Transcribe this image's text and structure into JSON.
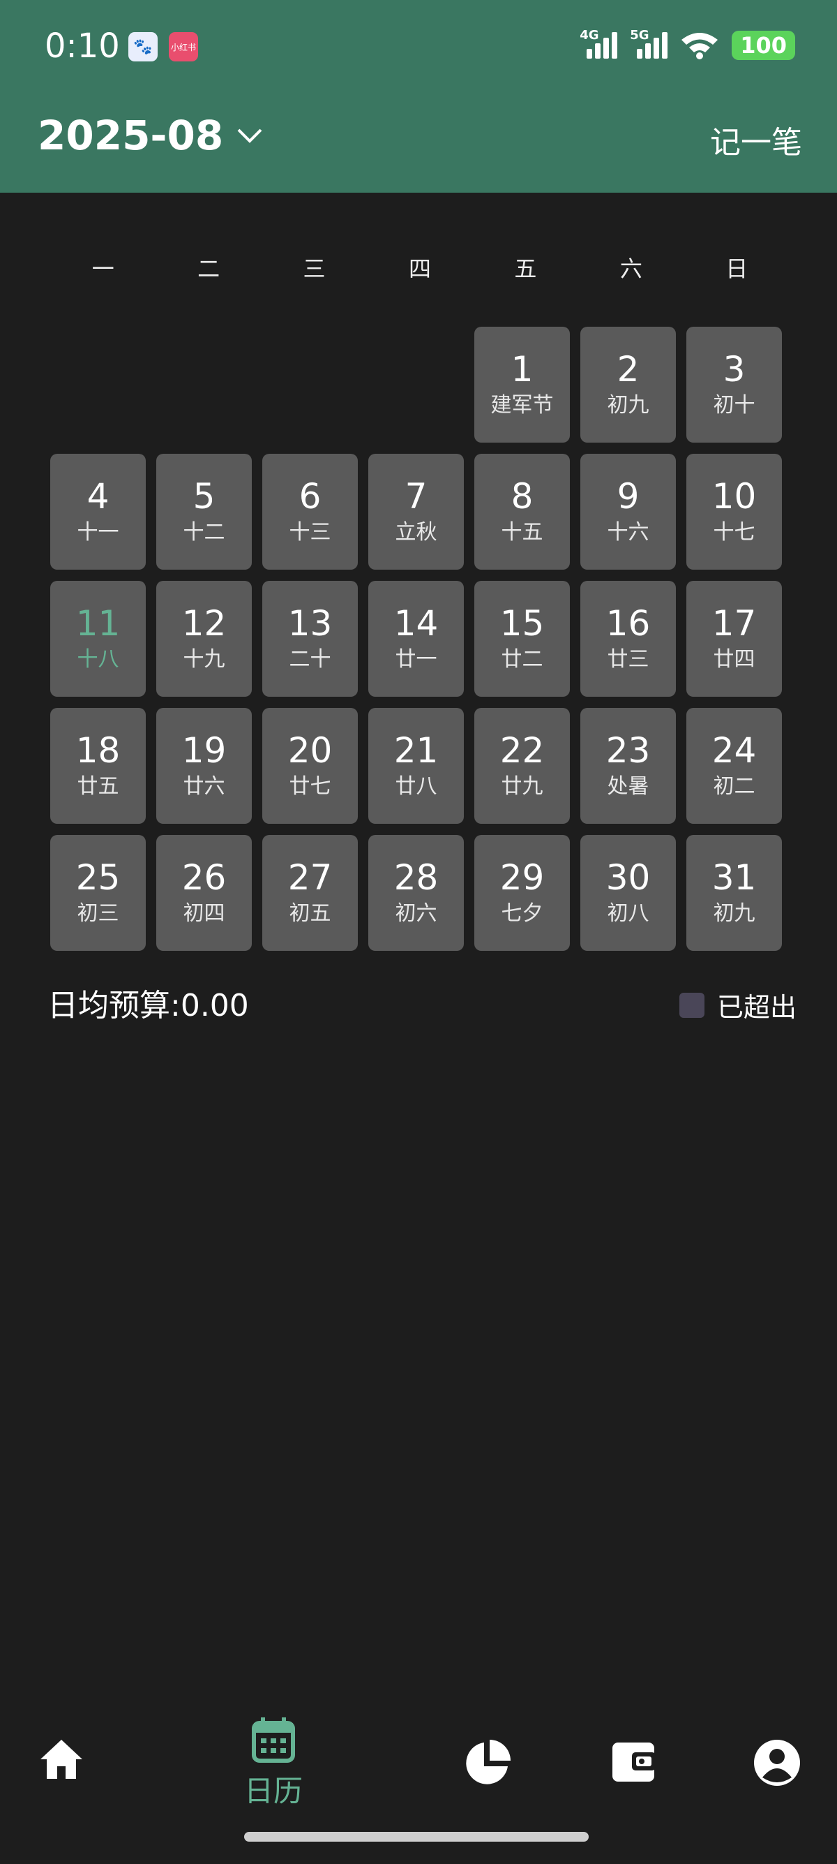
{
  "status": {
    "time": "0:10",
    "net1": "4G",
    "net2": "5G",
    "battery": "100"
  },
  "apps": {
    "app2": "小红书"
  },
  "header": {
    "month": "2025-08",
    "record": "记一笔"
  },
  "weekdays": [
    "一",
    "二",
    "三",
    "四",
    "五",
    "六",
    "日"
  ],
  "days": [
    {
      "num": "",
      "lunar": ""
    },
    {
      "num": "",
      "lunar": ""
    },
    {
      "num": "",
      "lunar": ""
    },
    {
      "num": "",
      "lunar": ""
    },
    {
      "num": "1",
      "lunar": "建军节"
    },
    {
      "num": "2",
      "lunar": "初九"
    },
    {
      "num": "3",
      "lunar": "初十"
    },
    {
      "num": "4",
      "lunar": "十一"
    },
    {
      "num": "5",
      "lunar": "十二"
    },
    {
      "num": "6",
      "lunar": "十三"
    },
    {
      "num": "7",
      "lunar": "立秋"
    },
    {
      "num": "8",
      "lunar": "十五"
    },
    {
      "num": "9",
      "lunar": "十六"
    },
    {
      "num": "10",
      "lunar": "十七"
    },
    {
      "num": "11",
      "lunar": "十八"
    },
    {
      "num": "12",
      "lunar": "十九"
    },
    {
      "num": "13",
      "lunar": "二十"
    },
    {
      "num": "14",
      "lunar": "廿一"
    },
    {
      "num": "15",
      "lunar": "廿二"
    },
    {
      "num": "16",
      "lunar": "廿三"
    },
    {
      "num": "17",
      "lunar": "廿四"
    },
    {
      "num": "18",
      "lunar": "廿五"
    },
    {
      "num": "19",
      "lunar": "廿六"
    },
    {
      "num": "20",
      "lunar": "廿七"
    },
    {
      "num": "21",
      "lunar": "廿八"
    },
    {
      "num": "22",
      "lunar": "廿九"
    },
    {
      "num": "23",
      "lunar": "处暑"
    },
    {
      "num": "24",
      "lunar": "初二"
    },
    {
      "num": "25",
      "lunar": "初三"
    },
    {
      "num": "26",
      "lunar": "初四"
    },
    {
      "num": "27",
      "lunar": "初五"
    },
    {
      "num": "28",
      "lunar": "初六"
    },
    {
      "num": "29",
      "lunar": "七夕"
    },
    {
      "num": "30",
      "lunar": "初八"
    },
    {
      "num": "31",
      "lunar": "初九"
    }
  ],
  "today": "11",
  "budget": {
    "text": "日均预算:0.00"
  },
  "legend": {
    "label": "已超出"
  },
  "nav": {
    "calendar_label": "日历"
  },
  "colors": {
    "header": "#3a7761",
    "accent": "#65b394",
    "cell": "#5a5a5a",
    "background": "#1d1d1d"
  },
  "icons": [
    "home-icon",
    "calendar-icon",
    "pie-chart-icon",
    "wallet-icon",
    "profile-icon"
  ]
}
